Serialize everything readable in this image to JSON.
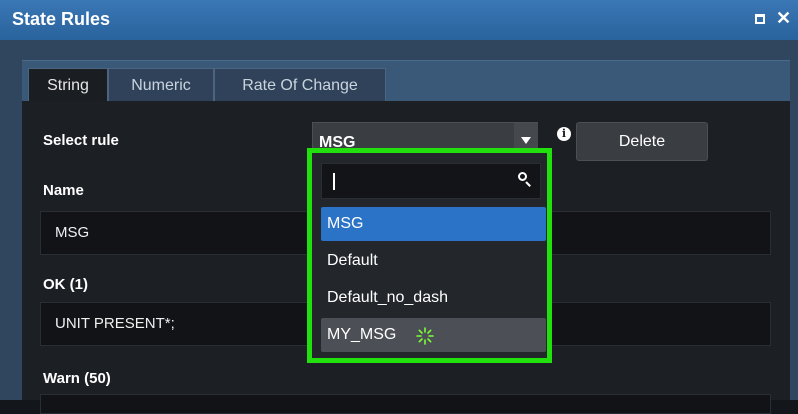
{
  "window": {
    "title": "State Rules"
  },
  "tabs": [
    {
      "label": "String",
      "active": true
    },
    {
      "label": "Numeric",
      "active": false
    },
    {
      "label": "Rate Of Change",
      "active": false
    }
  ],
  "select_rule": {
    "label": "Select rule",
    "value": "MSG",
    "delete_label": "Delete"
  },
  "fields": {
    "name": {
      "label": "Name",
      "value": "MSG"
    },
    "ok": {
      "label": "OK (1)",
      "value": "UNIT PRESENT*;"
    },
    "warn": {
      "label": "Warn (50)",
      "value": ""
    }
  },
  "dropdown": {
    "search_value": "",
    "options": [
      "MSG",
      "Default",
      "Default_no_dash",
      "MY_MSG"
    ],
    "selected": "MSG",
    "highlight_color": "#22e00e"
  },
  "colors": {
    "accent": "#2b73c7",
    "titlebar": "#2f6aa8"
  }
}
